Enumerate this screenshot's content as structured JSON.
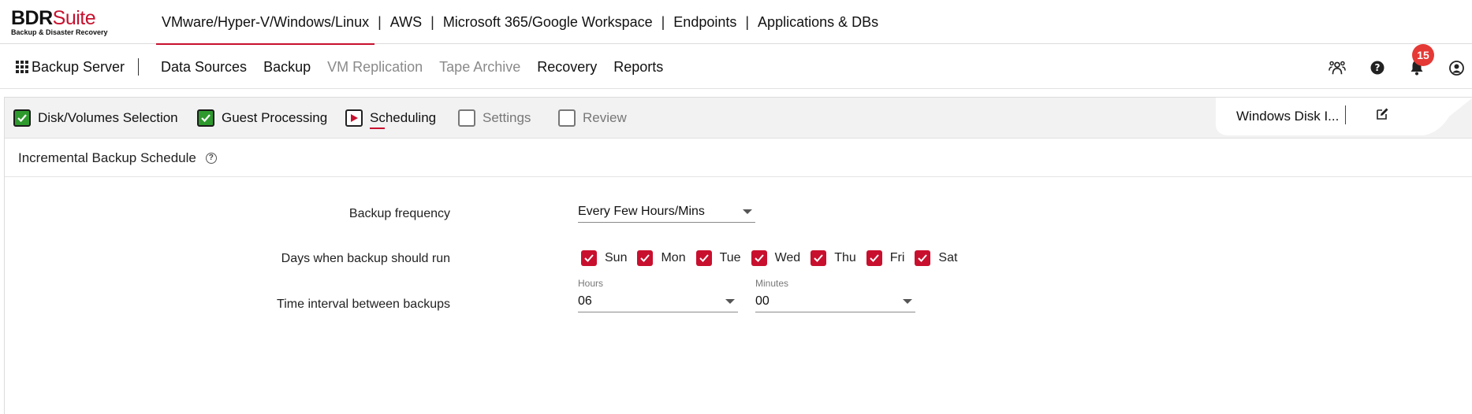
{
  "brand": {
    "name_part1": "BDR",
    "name_part2": "Suite",
    "tagline": "Backup & Disaster Recovery",
    "accent_color": "#c8102e"
  },
  "product_nav": {
    "items": [
      {
        "label": "VMware/Hyper-V/Windows/Linux",
        "active": true
      },
      {
        "label": "AWS",
        "active": false
      },
      {
        "label": "Microsoft 365/Google Workspace",
        "active": false
      },
      {
        "label": "Endpoints",
        "active": false
      },
      {
        "label": "Applications & DBs",
        "active": false
      }
    ],
    "separator": "|"
  },
  "main_nav": {
    "server_label": "Backup Server",
    "menu": [
      {
        "label": "Data Sources",
        "enabled": true
      },
      {
        "label": "Backup",
        "enabled": true
      },
      {
        "label": "VM Replication",
        "enabled": false
      },
      {
        "label": "Tape Archive",
        "enabled": false
      },
      {
        "label": "Recovery",
        "enabled": true
      },
      {
        "label": "Reports",
        "enabled": true
      }
    ],
    "icons": [
      "users-icon",
      "help-icon",
      "bell-icon",
      "user-account-icon"
    ],
    "notification_count": "15"
  },
  "wizard": {
    "steps": [
      {
        "label": "Disk/Volumes Selection",
        "state": "done"
      },
      {
        "label": "Guest Processing",
        "state": "done"
      },
      {
        "label": "Scheduling",
        "state": "current"
      },
      {
        "label": "Settings",
        "state": "pending"
      },
      {
        "label": "Review",
        "state": "pending"
      }
    ],
    "job_name": "Windows Disk I..."
  },
  "section": {
    "title": "Incremental Backup Schedule",
    "help_glyph": "?"
  },
  "form": {
    "frequency_label": "Backup frequency",
    "frequency_value": "Every Few Hours/Mins",
    "days_label": "Days when backup should run",
    "days": [
      {
        "label": "Sun",
        "checked": true
      },
      {
        "label": "Mon",
        "checked": true
      },
      {
        "label": "Tue",
        "checked": true
      },
      {
        "label": "Wed",
        "checked": true
      },
      {
        "label": "Thu",
        "checked": true
      },
      {
        "label": "Fri",
        "checked": true
      },
      {
        "label": "Sat",
        "checked": true
      }
    ],
    "interval_label": "Time interval between backups",
    "hours_label": "Hours",
    "hours_value": "06",
    "minutes_label": "Minutes",
    "minutes_value": "00"
  }
}
